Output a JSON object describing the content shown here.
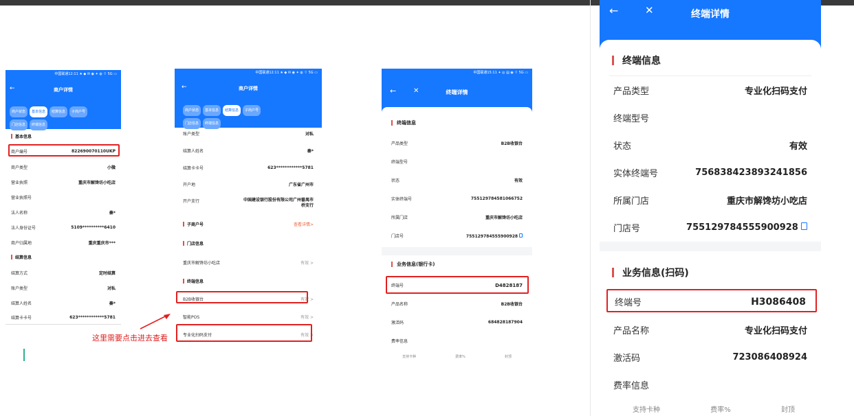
{
  "phone1": {
    "status": "中国联通12:11 ★ ◆ ✉ ◉ ✦ ◍ ⌔ 5G ▭",
    "title": "商户详情",
    "back": "←",
    "tabs": [
      "商户状态",
      "基本信息",
      "结算信息",
      "子商户号",
      "门店信息",
      "终端信息"
    ],
    "section_basic": "基本信息",
    "rows": [
      {
        "label": "商户编号",
        "value": "822690070110UKP"
      },
      {
        "label": "商户类型",
        "value": "小微"
      },
      {
        "label": "营业执照",
        "value": "重庆市解馋坊小吃店"
      },
      {
        "label": "营业执照号",
        "value": ""
      },
      {
        "label": "法人名称",
        "value": "秦*"
      },
      {
        "label": "法人身份证号",
        "value": "5109**********6410"
      },
      {
        "label": "商户归属地",
        "value": "重庆重庆市***"
      }
    ],
    "section_settle": "结算信息",
    "rows2": [
      {
        "label": "结算方式",
        "value": "定时结算"
      },
      {
        "label": "账户类型",
        "value": "对私"
      },
      {
        "label": "结算人姓名",
        "value": "秦*"
      },
      {
        "label": "结算卡卡号",
        "value": "623************5781"
      }
    ]
  },
  "phone2": {
    "status": "中国联通12:11 ★ ◆ ✉ ◉ ✦ ◍ ⌔ 5G ▭",
    "title": "商户详情",
    "back": "←",
    "tabs": [
      "商户状态",
      "基本信息",
      "结算信息",
      "子商户号",
      "门店信息",
      "终端信息"
    ],
    "rows": [
      {
        "label": "账户类型",
        "value": "对私"
      },
      {
        "label": "结算人姓名",
        "value": "秦*"
      },
      {
        "label": "结算卡卡号",
        "value": "623************5781"
      },
      {
        "label": "开户地",
        "value": "广东省广州市"
      },
      {
        "label": "开户支行",
        "value": "中国建设银行股份有限公司广州番禺市桥支行"
      }
    ],
    "section_sub": "子商户号",
    "view_detail": "查看详情>",
    "section_store": "门店信息",
    "store_name": "重庆市解馋坊小吃店",
    "store_status": "有效 >",
    "section_terminal": "终端信息",
    "terminals": [
      {
        "label": "B2B收银台",
        "status": "有效 >"
      },
      {
        "label": "智能POS",
        "status": "有效 >"
      },
      {
        "label": "专业化扫码支付",
        "status": "有效 >"
      }
    ],
    "annotation": "这里需要点击进去查看"
  },
  "phone3": {
    "status": "中国联通15:11 ✦ ◎ ▤  ◉ ⌔ 5G ▭",
    "title": "终端详情",
    "back": "←",
    "close": "✕",
    "section1": "终端信息",
    "rows": [
      {
        "label": "产品类型",
        "value": "B2B收银台"
      },
      {
        "label": "终端型号",
        "value": ""
      },
      {
        "label": "状态",
        "value": "有效"
      },
      {
        "label": "实体终端号",
        "value": "755129784581066752"
      },
      {
        "label": "所属门店",
        "value": "重庆市解馋坊小吃店"
      },
      {
        "label": "门店号",
        "value": "755129784555900928"
      }
    ],
    "section2": "业务信息(银行卡)",
    "rows2": [
      {
        "label": "终端号",
        "value": "D4828187"
      },
      {
        "label": "产品名称",
        "value": "B2B收银台"
      },
      {
        "label": "激活码",
        "value": "684828187904"
      },
      {
        "label": "费率信息",
        "value": ""
      }
    ],
    "rate_cols": [
      "支持卡种",
      "费率%",
      "封顶"
    ]
  },
  "phone4": {
    "title": "终端详情",
    "back": "←",
    "close": "✕",
    "section1": "终端信息",
    "rows": [
      {
        "label": "产品类型",
        "value": "专业化扫码支付"
      },
      {
        "label": "终端型号",
        "value": ""
      },
      {
        "label": "状态",
        "value": "有效"
      },
      {
        "label": "实体终端号",
        "value": "756838423893241856"
      },
      {
        "label": "所属门店",
        "value": "重庆市解馋坊小吃店"
      },
      {
        "label": "门店号",
        "value": "755129784555900928"
      }
    ],
    "section2": "业务信息(扫码)",
    "rows2": [
      {
        "label": "终端号",
        "value": "H3086408"
      },
      {
        "label": "产品名称",
        "value": "专业化扫码支付"
      },
      {
        "label": "激活码",
        "value": "723086408924"
      },
      {
        "label": "费率信息",
        "value": ""
      }
    ],
    "rate_cols": [
      "支持卡种",
      "费率%",
      "封顶"
    ]
  },
  "colors": {
    "brand": "#1677ff",
    "highlight": "#e02020",
    "section_bar": "#d9534f"
  }
}
